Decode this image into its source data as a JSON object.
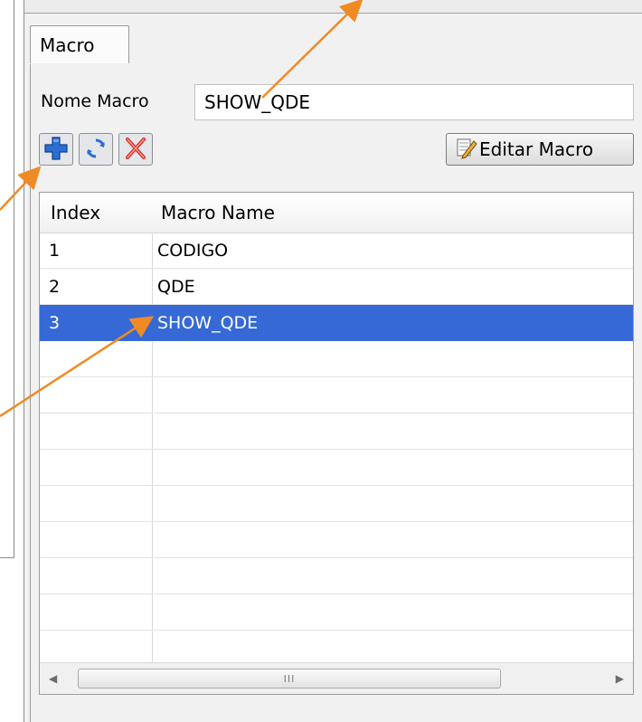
{
  "tab": {
    "label": "Macro"
  },
  "form": {
    "name_label": "Nome Macro",
    "name_value": "SHOW_QDE"
  },
  "toolbar": {
    "add_icon": "plus-icon",
    "refresh_icon": "refresh-icon",
    "delete_icon": "delete-x-icon",
    "edit_label": "Editar Macro",
    "edit_icon": "edit-pencil-icon"
  },
  "table": {
    "columns": [
      "Index",
      "Macro Name"
    ],
    "rows": [
      {
        "index": "1",
        "name": "CODIGO"
      },
      {
        "index": "2",
        "name": "QDE"
      },
      {
        "index": "3",
        "name": "SHOW_QDE",
        "selected": true
      }
    ]
  },
  "scrollbar": {
    "grip": "III"
  },
  "colors": {
    "selection": "#3669d6",
    "annotation_arrow": "#f08a24",
    "add_icon_blue": "#2c6fd1",
    "delete_icon_red": "#d9342b"
  }
}
